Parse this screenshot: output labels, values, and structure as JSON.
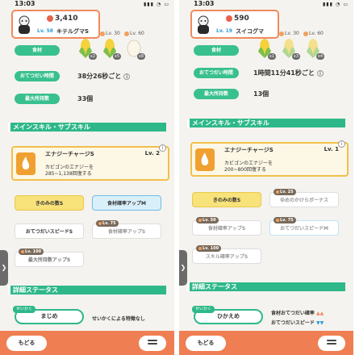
{
  "left": {
    "status_time": "13:03",
    "strength": "3,410",
    "level": "Lv. 58",
    "name": "キテルグマS",
    "ingredients": [
      {
        "level": "",
        "count": "x2",
        "kind": "corn"
      },
      {
        "level": "Lv. 30",
        "count": "x5",
        "kind": "corn"
      },
      {
        "level": "Lv. 60",
        "count": "x8",
        "kind": "egg"
      }
    ],
    "stats": [
      {
        "label": "食材",
        "value": ""
      },
      {
        "label": "おてつだい時間",
        "value": "38分26秒ごと"
      },
      {
        "label": "最大所持数",
        "value": "33個"
      }
    ],
    "section_skills": "メインスキル・サブスキル",
    "skill": {
      "name": "エナジーチャージS",
      "level": "Lv. 2",
      "desc1": "カビゴンのエナジーを",
      "desc2": "285~1,138回復する"
    },
    "subskills": [
      {
        "label": "きのみの数S",
        "tag": "",
        "style": "gold"
      },
      {
        "label": "食材確率アップM",
        "tag": "",
        "style": "blue"
      },
      {
        "label": "おてつだいスピードS",
        "tag": "",
        "style": "plain"
      },
      {
        "label": "食材確率アップS",
        "tag": "Lv. 75",
        "style": "locked"
      },
      {
        "label": "最大所持数アップS",
        "tag": "Lv. 100",
        "style": "muted"
      }
    ],
    "section_details": "詳細ステータス",
    "nature_tag": "せいかく",
    "nature": "まじめ",
    "nature_effect1": "せいかくによる特徴なし",
    "nature_effect2": "",
    "back": "もどる"
  },
  "right": {
    "status_time": "13:03",
    "strength": "590",
    "level": "Lv. 19",
    "name": "スイコグマ",
    "ingredients": [
      {
        "level": "",
        "count": "x1",
        "kind": "corn"
      },
      {
        "level": "Lv. 30",
        "count": "x3",
        "kind": "corn"
      },
      {
        "level": "Lv. 60",
        "count": "x4",
        "kind": "corn"
      }
    ],
    "stats": [
      {
        "label": "食材",
        "value": ""
      },
      {
        "label": "おてつだい時間",
        "value": "1時間11分41秒ごと"
      },
      {
        "label": "最大所持数",
        "value": "13個"
      }
    ],
    "section_skills": "メインスキル・サブスキル",
    "skill": {
      "name": "エナジーチャージS",
      "level": "Lv. 1",
      "desc1": "カビゴンのエナジーを",
      "desc2": "200~800回復する"
    },
    "subskills": [
      {
        "label": "きのみの数S",
        "tag": "",
        "style": "gold"
      },
      {
        "label": "ゆめのかけらボーナス",
        "tag": "Lv. 25",
        "style": "locked"
      },
      {
        "label": "食材確率アップS",
        "tag": "Lv. 50",
        "style": "locked"
      },
      {
        "label": "おてつだいスピードM",
        "tag": "Lv. 75",
        "style": "locked"
      },
      {
        "label": "スキル確率アップS",
        "tag": "Lv. 100",
        "style": "locked"
      }
    ],
    "section_details": "詳細ステータス",
    "nature_tag": "せいかく",
    "nature": "ひかえめ",
    "nature_effect1": "食材おてつだい確率",
    "nature_effect2": "おてつだいスピード",
    "back": "もどる"
  }
}
